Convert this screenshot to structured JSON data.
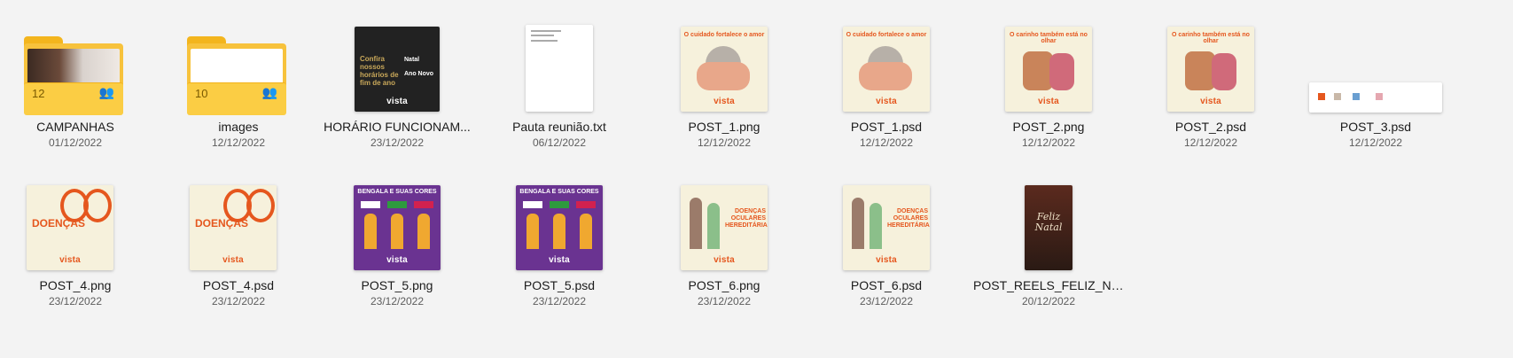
{
  "files": [
    {
      "name": "CAMPANHAS",
      "date": "01/12/2022",
      "type": "folder",
      "count": "12",
      "icon": "shared-people-icon"
    },
    {
      "name": "images",
      "date": "12/12/2022",
      "type": "folder",
      "count": "10",
      "icon": "shared-people-icon"
    },
    {
      "name": "HORÁRIO FUNCIONAM...",
      "date": "23/12/2022",
      "type": "image",
      "thumb_text": "Confira nossos horários de fim de ano",
      "thumb_right1": "Natal",
      "thumb_right2": "Ano Novo"
    },
    {
      "name": "Pauta reunião.txt",
      "date": "06/12/2022",
      "type": "text"
    },
    {
      "name": "POST_1.png",
      "date": "12/12/2022",
      "type": "image",
      "thumb_text": "O cuidado fortalece o amor"
    },
    {
      "name": "POST_1.psd",
      "date": "12/12/2022",
      "type": "image",
      "thumb_text": "O cuidado fortalece o amor"
    },
    {
      "name": "POST_2.png",
      "date": "12/12/2022",
      "type": "image",
      "thumb_text": "O carinho também está no olhar"
    },
    {
      "name": "POST_2.psd",
      "date": "12/12/2022",
      "type": "image",
      "thumb_text": "O carinho também está no olhar"
    },
    {
      "name": "POST_3.psd",
      "date": "12/12/2022",
      "type": "image"
    },
    {
      "name": "POST_4.png",
      "date": "23/12/2022",
      "type": "image",
      "thumb_text": "DOENÇAS"
    },
    {
      "name": "POST_4.psd",
      "date": "23/12/2022",
      "type": "image",
      "thumb_text": "DOENÇAS"
    },
    {
      "name": "POST_5.png",
      "date": "23/12/2022",
      "type": "image",
      "thumb_text": "BENGALA E SUAS CORES"
    },
    {
      "name": "POST_5.psd",
      "date": "23/12/2022",
      "type": "image",
      "thumb_text": "BENGALA E SUAS CORES"
    },
    {
      "name": "POST_6.png",
      "date": "23/12/2022",
      "type": "image",
      "thumb_text": "DOENÇAS OCULARES HEREDITÁRIAS"
    },
    {
      "name": "POST_6.psd",
      "date": "23/12/2022",
      "type": "image",
      "thumb_text": "DOENÇAS OCULARES HEREDITÁRIAS"
    },
    {
      "name": "POST_REELS_FELIZ_NAT...",
      "date": "20/12/2022",
      "type": "image",
      "thumb_text": "Feliz Natal"
    }
  ],
  "brand": "vista",
  "colors": {
    "accent_orange": "#e5571e",
    "folder_yellow": "#f7c23c",
    "purple": "#6a3391",
    "cream": "#f6f1dc"
  }
}
